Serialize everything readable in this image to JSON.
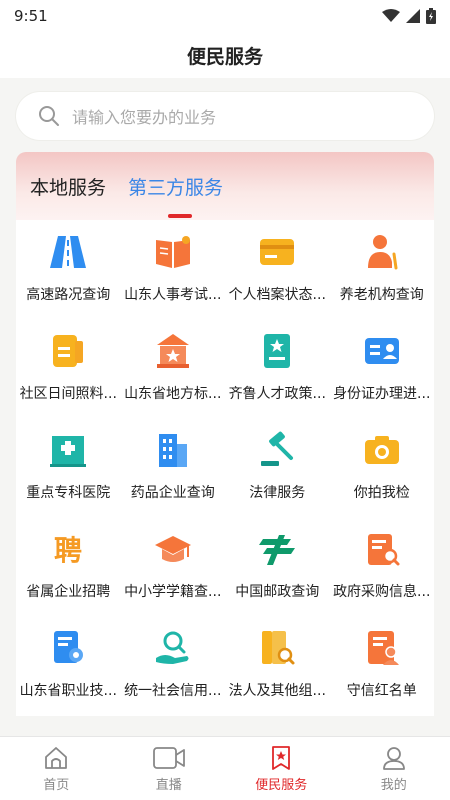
{
  "status_bar": {
    "time": "9:51"
  },
  "header": {
    "title": "便民服务"
  },
  "search": {
    "placeholder": "请输入您要办的业务"
  },
  "tabs": [
    {
      "label": "本地服务"
    },
    {
      "label": "第三方服务"
    }
  ],
  "services": [
    {
      "label": "高速路况查询"
    },
    {
      "label": "山东人事考试..."
    },
    {
      "label": "个人档案状态..."
    },
    {
      "label": "养老机构查询"
    },
    {
      "label": "社区日间照料..."
    },
    {
      "label": "山东省地方标..."
    },
    {
      "label": "齐鲁人才政策..."
    },
    {
      "label": "身份证办理进..."
    },
    {
      "label": "重点专科医院"
    },
    {
      "label": "药品企业查询"
    },
    {
      "label": "法律服务"
    },
    {
      "label": "你拍我检"
    },
    {
      "label": "省属企业招聘"
    },
    {
      "label": "中小学学籍查..."
    },
    {
      "label": "中国邮政查询"
    },
    {
      "label": "政府采购信息..."
    },
    {
      "label": "山东省职业技..."
    },
    {
      "label": "统一社会信用..."
    },
    {
      "label": "法人及其他组..."
    },
    {
      "label": "守信红名单"
    }
  ],
  "bottom_nav": [
    {
      "label": "首页"
    },
    {
      "label": "直播"
    },
    {
      "label": "便民服务"
    },
    {
      "label": "我的"
    }
  ],
  "colors": {
    "active_tab": "#3b86e6",
    "accent_red": "#e0282a",
    "icon_orange": "#f59a23",
    "icon_blue": "#2f8df0",
    "icon_teal": "#14b0a3"
  }
}
